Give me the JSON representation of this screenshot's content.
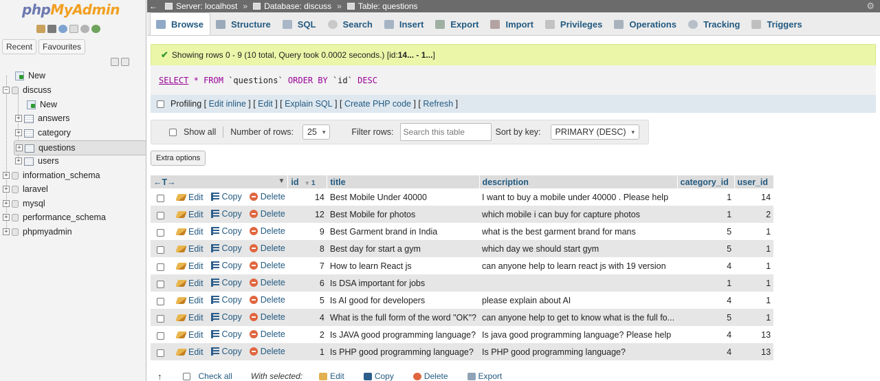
{
  "app": {
    "logo_php": "php",
    "logo_my": "MyAdmin"
  },
  "nav": {
    "recent_label": "Recent",
    "favourites_label": "Favourites",
    "tree": {
      "new_label": "New",
      "db_discuss": "discuss",
      "discuss_new": "New",
      "tables": [
        "answers",
        "category",
        "questions",
        "users"
      ],
      "other_dbs": [
        "information_schema",
        "laravel",
        "mysql",
        "performance_schema",
        "phpmyadmin"
      ]
    }
  },
  "breadcrumb": {
    "server": "Server: localhost",
    "database": "Database: discuss",
    "table": "Table: questions",
    "sep": "»"
  },
  "tabs": [
    "Browse",
    "Structure",
    "SQL",
    "Search",
    "Insert",
    "Export",
    "Import",
    "Privileges",
    "Operations",
    "Tracking",
    "Triggers"
  ],
  "message": {
    "prefix": "Showing rows 0 - 9 (10 total, Query took 0.0002 seconds.) [id: ",
    "bold": "14... - 1...",
    "suffix": "]"
  },
  "sql": {
    "select": "SELECT",
    "star": "*",
    "from": "FROM",
    "table": "`questions`",
    "order": "ORDER BY",
    "col": "`id`",
    "dir": "DESC"
  },
  "profiling": {
    "label": "Profiling",
    "links": [
      "Edit inline",
      "Edit",
      "Explain SQL",
      "Create PHP code",
      "Refresh"
    ]
  },
  "controls": {
    "show_all": "Show all",
    "num_rows_label": "Number of rows:",
    "num_rows_value": "25",
    "filter_label": "Filter rows:",
    "filter_placeholder": "Search this table",
    "sort_label": "Sort by key:",
    "sort_value": "PRIMARY (DESC)",
    "extra_options": "Extra options"
  },
  "table": {
    "columns": [
      "id",
      "title",
      "description",
      "category_id",
      "user_id"
    ],
    "sort_indicator": "1",
    "actions": {
      "edit": "Edit",
      "copy": "Copy",
      "delete": "Delete"
    },
    "rows": [
      {
        "id": "14",
        "title": "Best Mobile Under 40000",
        "description": "I want to buy a mobile under 40000 . Please help",
        "category_id": "1",
        "user_id": "14"
      },
      {
        "id": "12",
        "title": "Best Mobile for photos",
        "description": "which mobile i can buy for capture photos",
        "category_id": "1",
        "user_id": "2"
      },
      {
        "id": "9",
        "title": "Best Garment brand in India",
        "description": "what is the best garment brand for mans",
        "category_id": "5",
        "user_id": "1"
      },
      {
        "id": "8",
        "title": "Best day for start a gym",
        "description": "which day we should start gym",
        "category_id": "5",
        "user_id": "1"
      },
      {
        "id": "7",
        "title": "How to learn React js",
        "description": "can anyone help to learn react js with 19 version",
        "category_id": "4",
        "user_id": "1"
      },
      {
        "id": "6",
        "title": "Is DSA important for jobs",
        "description": "",
        "category_id": "1",
        "user_id": "1"
      },
      {
        "id": "5",
        "title": "Is AI good for developers",
        "description": "please explain about AI",
        "category_id": "4",
        "user_id": "1"
      },
      {
        "id": "4",
        "title": "What is the full form of the word \"OK\"?",
        "description": "can anyone help to get to know what is the full fo...",
        "category_id": "5",
        "user_id": "1"
      },
      {
        "id": "2",
        "title": "Is JAVA good programming language?",
        "description": "Is java good programming language? Please help",
        "category_id": "4",
        "user_id": "13"
      },
      {
        "id": "1",
        "title": "Is PHP good programming language?",
        "description": "Is PHP good programming language?",
        "category_id": "4",
        "user_id": "13"
      }
    ]
  },
  "bottom": {
    "check_all": "Check all",
    "with_selected": "With selected:",
    "edit": "Edit",
    "copy": "Copy",
    "delete": "Delete",
    "export": "Export"
  },
  "colors": {
    "link": "#235a81",
    "success_bg": "#ebf6a8",
    "topbar": "#6b6b6b"
  }
}
